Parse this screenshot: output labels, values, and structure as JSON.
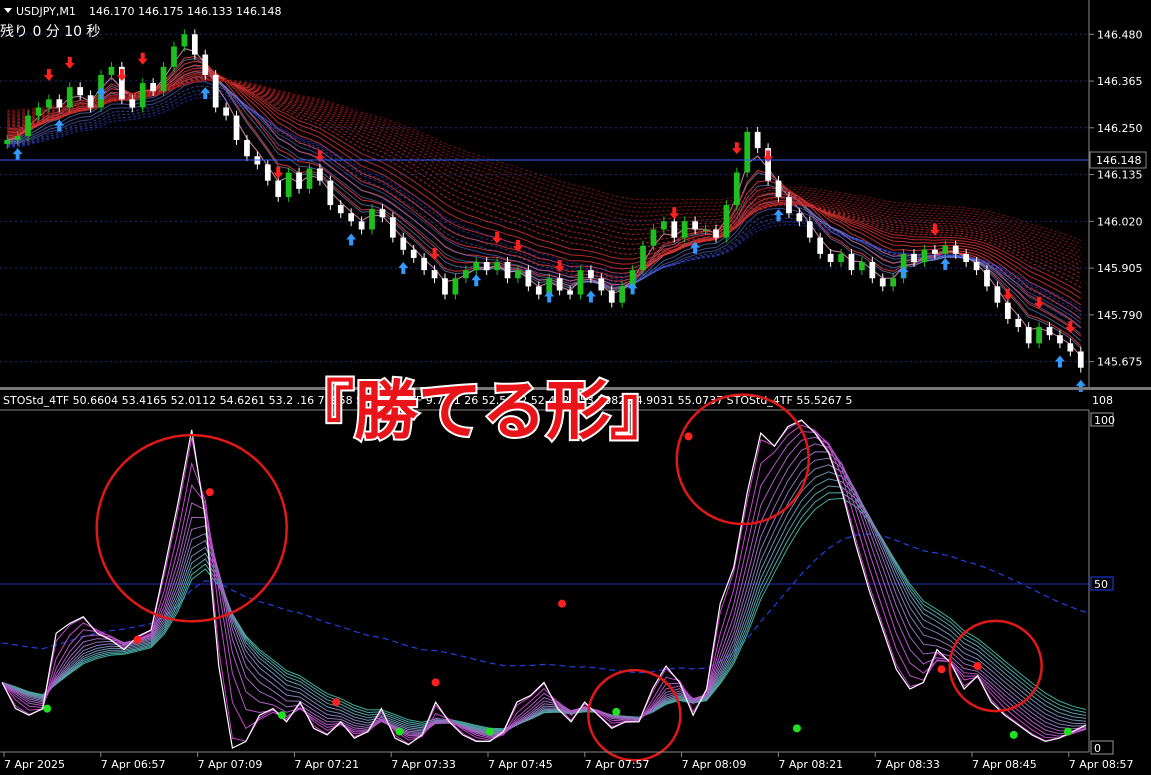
{
  "header": {
    "symbol": "USDJPY,M1",
    "ohlc": "146.170 146.175 146.133 146.148",
    "remaining": "残り 0 分 10 秒"
  },
  "banner": {
    "text": "『勝てる形』"
  },
  "colors": {
    "background": "#000000",
    "bull_candle": "#1fbf1f",
    "bear_candle": "#ffffff",
    "up_arrow": "#3399ff",
    "down_arrow": "#ff2020",
    "ribbon_red": "#cc1a1a",
    "ribbon_blue": "#4a6cff",
    "stoch_magenta": "#d040d0",
    "stoch_teal": "#40b0a0",
    "stoch_white": "#ffffff",
    "grid": "#1a2a80",
    "circle": "#e01818"
  },
  "chart_data": [
    {
      "type": "candlestick",
      "title": "USDJPY,M1",
      "ylim": [
        145.62,
        146.52
      ],
      "y_ticks": [
        "146.480",
        "146.365",
        "146.250",
        "146.135",
        "146.020",
        "145.905",
        "145.790",
        "145.675"
      ],
      "current_price": "146.148",
      "price_path": [
        146.22,
        146.23,
        146.28,
        146.3,
        146.32,
        146.3,
        146.35,
        146.33,
        146.3,
        146.38,
        146.4,
        146.32,
        146.3,
        146.36,
        146.34,
        146.4,
        146.45,
        146.48,
        146.43,
        146.38,
        146.3,
        146.28,
        146.22,
        146.18,
        146.16,
        146.12,
        146.08,
        146.14,
        146.1,
        146.15,
        146.12,
        146.06,
        146.04,
        146.02,
        146.0,
        146.05,
        146.03,
        145.98,
        145.95,
        145.93,
        145.9,
        145.88,
        145.84,
        145.88,
        145.9,
        145.92,
        145.9,
        145.92,
        145.88,
        145.9,
        145.86,
        145.84,
        145.88,
        145.85,
        145.84,
        145.9,
        145.88,
        145.85,
        145.82,
        145.86,
        145.9,
        145.96,
        146.0,
        146.02,
        145.98,
        146.02,
        146.0,
        146.0,
        145.98,
        146.06,
        146.14,
        146.24,
        146.2,
        146.12,
        146.08,
        146.04,
        146.02,
        145.98,
        145.94,
        145.92,
        145.94,
        145.9,
        145.92,
        145.88,
        145.86,
        145.88,
        145.94,
        145.92,
        145.95,
        145.94,
        145.96,
        145.94,
        145.92,
        145.9,
        145.86,
        145.82,
        145.78,
        145.76,
        145.72,
        145.76,
        145.74,
        145.72,
        145.7,
        145.66
      ],
      "up_arrow_indices": [
        1,
        5,
        9,
        19,
        33,
        38,
        45,
        52,
        56,
        60,
        66,
        74,
        86,
        90,
        101,
        103
      ],
      "down_arrow_indices": [
        4,
        6,
        11,
        13,
        26,
        30,
        41,
        47,
        49,
        53,
        64,
        70,
        73,
        89,
        96,
        99,
        102
      ]
    },
    {
      "type": "line",
      "title": "STOStd_4TF",
      "status_line": "STOStd_4TF 50.6604 53.4165 52.0112 54.6261 53.2 .16 7 .958 STOStd_4TF 9.7 51 26 52.5622 52.4625 53.3082 54.9031 55.0737 STOStd_4TF 55.5267 5",
      "ylim": [
        0,
        100
      ],
      "y_ticks": [
        "100",
        "50",
        "0"
      ],
      "scale_top_label": "108",
      "x_ticks": [
        "7 Apr 2025",
        "7 Apr 06:57",
        "7 Apr 07:09",
        "7 Apr 07:21",
        "7 Apr 07:33",
        "7 Apr 07:45",
        "7 Apr 07:57",
        "7 Apr 08:09",
        "7 Apr 08:21",
        "7 Apr 08:33",
        "7 Apr 08:45",
        "7 Apr 08:57"
      ],
      "series": [
        {
          "values": [
            20,
            12,
            10,
            12,
            35,
            38,
            40,
            35,
            33,
            30,
            34,
            36,
            55,
            75,
            97,
            70,
            25,
            0,
            2,
            10,
            12,
            8,
            14,
            6,
            4,
            8,
            3,
            5,
            12,
            3,
            1,
            4,
            14,
            8,
            4,
            2,
            2,
            5,
            14,
            16,
            20,
            12,
            8,
            14,
            10,
            6,
            8,
            8,
            18,
            25,
            20,
            10,
            18,
            44,
            55,
            78,
            96,
            92,
            98,
            100,
            96,
            90,
            78,
            62,
            48,
            36,
            24,
            18,
            20,
            30,
            26,
            18,
            22,
            14,
            10,
            7,
            4,
            2,
            3,
            5,
            7
          ]
        }
      ],
      "signals_red": [
        [
          15,
          33
        ],
        [
          23,
          78
        ],
        [
          37,
          14
        ],
        [
          48,
          20
        ],
        [
          62,
          44
        ],
        [
          76,
          95
        ],
        [
          104,
          24
        ],
        [
          108,
          25
        ]
      ],
      "signals_green": [
        [
          5,
          12
        ],
        [
          31,
          10
        ],
        [
          44,
          5
        ],
        [
          54,
          5
        ],
        [
          68,
          11
        ],
        [
          88,
          6
        ],
        [
          112,
          4
        ],
        [
          118,
          5
        ]
      ],
      "circles": [
        [
          21,
          67
        ],
        [
          70,
          10
        ],
        [
          82,
          88
        ],
        [
          110,
          25
        ]
      ]
    }
  ]
}
